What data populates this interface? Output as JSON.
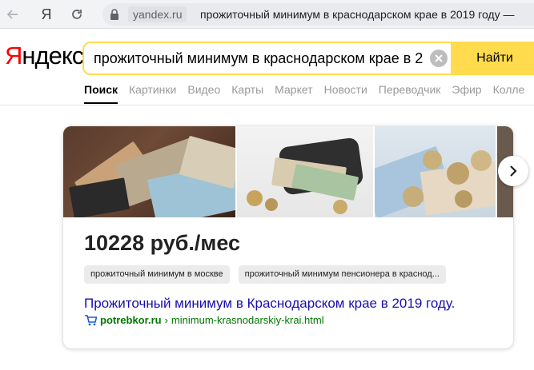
{
  "browser": {
    "home_glyph": "Я",
    "domain": "yandex.ru",
    "page_title": "прожиточный минимум в краснодарском крае в 2019 году —"
  },
  "header": {
    "logo_first": "Я",
    "logo_rest": "ндекс",
    "search_query": "прожиточный минимум в краснодарском крае в 2",
    "search_button": "Найти"
  },
  "tabs": [
    {
      "label": "Поиск",
      "active": true
    },
    {
      "label": "Картинки"
    },
    {
      "label": "Видео"
    },
    {
      "label": "Карты"
    },
    {
      "label": "Маркет"
    },
    {
      "label": "Новости"
    },
    {
      "label": "Переводчик"
    },
    {
      "label": "Эфир"
    },
    {
      "label": "Колле"
    }
  ],
  "card": {
    "value": "10228 руб./мес",
    "chips": [
      "прожиточный минимум в москве",
      "прожиточный минимум пенсионера в краснод..."
    ],
    "result_title": "Прожиточный минимум в Краснодарском крае в 2019 году.",
    "result_host": "potrebkor.ru",
    "result_separator": "›",
    "result_path": "minimum-krasnodarskiy-krai.html"
  },
  "colors": {
    "brand_red": "#ff0000",
    "search_yellow": "#ffdb4d",
    "link_blue": "#1a0dab",
    "url_green": "#007700"
  },
  "icons": [
    "back-arrow-icon",
    "reload-icon",
    "lock-icon",
    "clear-icon",
    "chevron-right-icon",
    "cart-icon"
  ]
}
